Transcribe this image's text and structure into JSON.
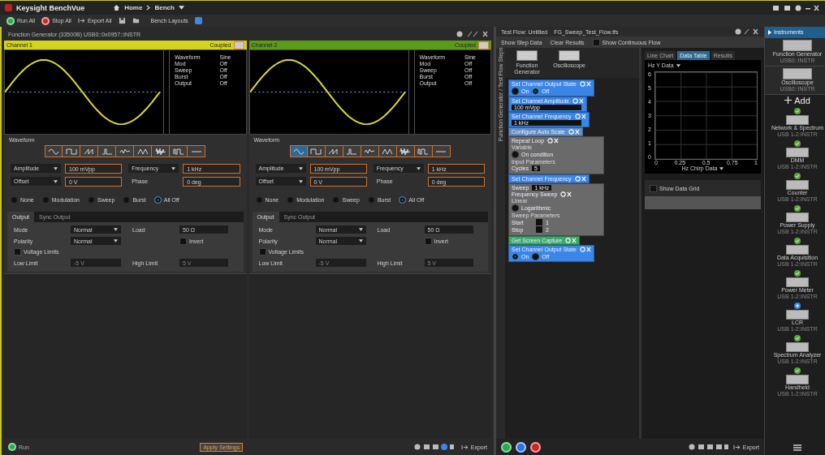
{
  "app": {
    "title": "Keysight BenchVue",
    "breadcrumb": [
      "Home",
      "Bench"
    ]
  },
  "toolbar": {
    "buttons": [
      {
        "label": "Run All",
        "kind": "run"
      },
      {
        "label": "Stop All",
        "kind": "stop"
      },
      {
        "label": "Export All",
        "kind": "export"
      }
    ],
    "layouts_label": "Bench Layouts"
  },
  "instrument": {
    "title": "Function Generator (33500B) USB0::0x0957::INSTR"
  },
  "channels": [
    {
      "name": "Channel 1",
      "color": "#d4d420",
      "coupled": "Coupled",
      "info": [
        [
          "Waveform",
          "Sine"
        ],
        [
          "Mod",
          "Off"
        ],
        [
          "Sweep",
          "Off"
        ],
        [
          "Burst",
          "Off"
        ],
        [
          "Output",
          "Off"
        ]
      ],
      "waveform_label": "Waveform",
      "shapes": [
        {
          "kind": "sine",
          "selected": false
        },
        {
          "kind": "square",
          "selected": false
        },
        {
          "kind": "ramp",
          "selected": false
        },
        {
          "kind": "pulse",
          "selected": false
        },
        {
          "kind": "arb",
          "selected": false
        },
        {
          "kind": "triangle",
          "selected": false
        },
        {
          "kind": "noise",
          "selected": false
        },
        {
          "kind": "prbs",
          "selected": false
        },
        {
          "kind": "dc",
          "selected": false
        }
      ],
      "params": [
        {
          "label": "Amplitude",
          "value": "100 mVpp",
          "dropdown": true
        },
        {
          "label": "Frequency",
          "value": "1 kHz",
          "dropdown": true
        },
        {
          "label": "Offset",
          "value": "0 V",
          "dropdown": true
        },
        {
          "label": "Phase",
          "value": "0 deg",
          "dropdown": false
        }
      ],
      "modes": [
        {
          "label": "None",
          "selected": false
        },
        {
          "label": "Modulation",
          "selected": false
        },
        {
          "label": "Sweep",
          "selected": false
        },
        {
          "label": "Burst",
          "selected": false
        },
        {
          "label": "All Off",
          "selected": true
        }
      ],
      "tabs": [
        {
          "label": "Output",
          "selected": true
        },
        {
          "label": "Sync Output",
          "selected": false
        }
      ],
      "settings": {
        "mode_label": "Mode",
        "mode": "Normal",
        "load_label": "Load",
        "load": "50 Ω",
        "polarity_label": "Polarity",
        "polarity": "Normal",
        "invert_label": "Invert",
        "invert": false,
        "limits_label": "Voltage Limits",
        "limits": false,
        "low_label": "Low Limit",
        "low": "-5 V",
        "high_label": "High Limit",
        "high": "5 V"
      }
    },
    {
      "name": "Channel 2",
      "color": "#5c9a1c",
      "coupled": "Coupled",
      "info": [
        [
          "Waveform",
          "Sine"
        ],
        [
          "Mod",
          "Off"
        ],
        [
          "Sweep",
          "Off"
        ],
        [
          "Burst",
          "Off"
        ],
        [
          "Output",
          "Off"
        ]
      ],
      "waveform_label": "Waveform",
      "shapes": [
        {
          "kind": "sine",
          "selected": true
        },
        {
          "kind": "square",
          "selected": false
        },
        {
          "kind": "ramp",
          "selected": false
        },
        {
          "kind": "pulse",
          "selected": false
        },
        {
          "kind": "arb",
          "selected": false
        },
        {
          "kind": "triangle",
          "selected": false
        },
        {
          "kind": "noise",
          "selected": false
        },
        {
          "kind": "prbs",
          "selected": false
        },
        {
          "kind": "dc",
          "selected": false
        }
      ],
      "params": [
        {
          "label": "Amplitude",
          "value": "100 mVpp",
          "dropdown": true
        },
        {
          "label": "Frequency",
          "value": "1 kHz",
          "dropdown": true
        },
        {
          "label": "Offset",
          "value": "0 V",
          "dropdown": true
        },
        {
          "label": "Phase",
          "value": "0 deg",
          "dropdown": false
        }
      ],
      "modes": [
        {
          "label": "None",
          "selected": false
        },
        {
          "label": "Modulation",
          "selected": false
        },
        {
          "label": "Sweep",
          "selected": false
        },
        {
          "label": "Burst",
          "selected": false
        },
        {
          "label": "All Off",
          "selected": true
        }
      ],
      "tabs": [
        {
          "label": "Output",
          "selected": true
        },
        {
          "label": "Sync Output",
          "selected": false
        }
      ],
      "settings": {
        "mode_label": "Mode",
        "mode": "Normal",
        "load_label": "Load",
        "load": "50 Ω",
        "polarity_label": "Polarity",
        "polarity": "Normal",
        "invert_label": "Invert",
        "invert": false,
        "limits_label": "Voltage Limits",
        "limits": false,
        "low_label": "Low Limit",
        "low": "-5 V",
        "high_label": "High Limit",
        "high": "5 V"
      }
    }
  ],
  "bench_footer": {
    "run": "Run",
    "apply": "Apply Settings",
    "export": "Export"
  },
  "test_flow": {
    "title": "Test Flow: Untitled",
    "file": "FG_Sweep_Test_Flow.tfs",
    "actions": [
      "Show Step Data",
      "Clear Results"
    ],
    "continuous_label": "Show Continuous Flow",
    "continuous": false,
    "side_label": "Function Generator / Test Flow Steps",
    "palette": [
      "Function Generator",
      "Oscilloscope"
    ],
    "blocks": [
      {
        "kind": "state",
        "color": "#3a86e8",
        "title": "Set Channel Output State",
        "options": [
          {
            "label": "On",
            "selected": false
          },
          {
            "label": "Off",
            "selected": true
          }
        ]
      },
      {
        "kind": "value",
        "color": "#3a86e8",
        "title": "Set Channel Amplitude",
        "value": "100 mVpp"
      },
      {
        "kind": "value",
        "color": "#3a86e8",
        "title": "Set Channel Frequency",
        "value": "1 kHz"
      },
      {
        "kind": "step",
        "color": "#5f8fc8",
        "title": "Configure Auto Scale"
      },
      {
        "kind": "loop",
        "color": "#6a6a6a",
        "title": "Repeat Loop",
        "variable": "Variable",
        "checkbox_label": "On condition",
        "checked": false,
        "group_label": "Input Parameters",
        "count_label": "Cycles",
        "count": "5"
      },
      {
        "kind": "step",
        "color": "#3a86e8",
        "title": "Set Channel Frequency"
      },
      {
        "kind": "sweep",
        "color": "#6a6a6a",
        "prefix": "Sweep",
        "value": "1 kHz",
        "title": "Frequency Sweep",
        "subtitle": "Linear",
        "checkbox_label": "Logarithmic",
        "checked": false,
        "group_label": "Sweep Parameters",
        "rows": [
          [
            "Start",
            "1"
          ],
          [
            "Stop",
            "2"
          ]
        ]
      },
      {
        "kind": "step",
        "color": "#3aa86a",
        "title": "Get Screen Capture"
      },
      {
        "kind": "state",
        "color": "#3a86e8",
        "title": "Set Channel Output State",
        "options": [
          {
            "label": "On",
            "selected": true
          },
          {
            "label": "Off",
            "selected": false
          }
        ]
      }
    ],
    "results_tabs": [
      {
        "label": "Line Chart",
        "selected": false
      },
      {
        "label": "Data Table",
        "selected": true
      },
      {
        "label": "Results",
        "selected": false
      }
    ],
    "chart_selector": "Hz Y Data",
    "chart_x_label": "Hz Chirp Data",
    "y_ticks": [
      "6",
      "5",
      "4",
      "3",
      "2",
      "1",
      "0"
    ],
    "x_ticks": [
      "0",
      "0.25",
      "0.5",
      "0.75",
      "1"
    ],
    "show_data_label": "Show Data Grid",
    "show_data_grid": false,
    "footer_export": "Export"
  },
  "instruments": {
    "header": "Instruments",
    "connected": [
      {
        "name": "Function Generator",
        "address": "USB0::INSTR"
      },
      {
        "name": "Oscilloscope",
        "address": "USB0::INSTR"
      }
    ],
    "add_label": "Add",
    "available": [
      {
        "name": "Network & Spectrum",
        "address": "USB 1-2:INSTR",
        "connected": true
      },
      {
        "name": "DMM",
        "address": "USB 1-2:INSTR",
        "connected": true
      },
      {
        "name": "Counter",
        "address": "USB 1-2:INSTR",
        "connected": true
      },
      {
        "name": "Power Supply",
        "address": "USB 1-2:INSTR",
        "connected": true
      },
      {
        "name": "Data Acquisition",
        "address": "USB 1-2:INSTR",
        "connected": true
      },
      {
        "name": "Power Meter",
        "address": "USB 1-2:INSTR",
        "connected": true
      },
      {
        "name": "LCR",
        "address": "USB 1-2:INSTR",
        "connected": false
      },
      {
        "name": "Spectrum Analyzer",
        "address": "USB 1-2:INSTR",
        "connected": true
      },
      {
        "name": "Handheld",
        "address": "USB 1-2:INSTR",
        "connected": true
      }
    ]
  }
}
